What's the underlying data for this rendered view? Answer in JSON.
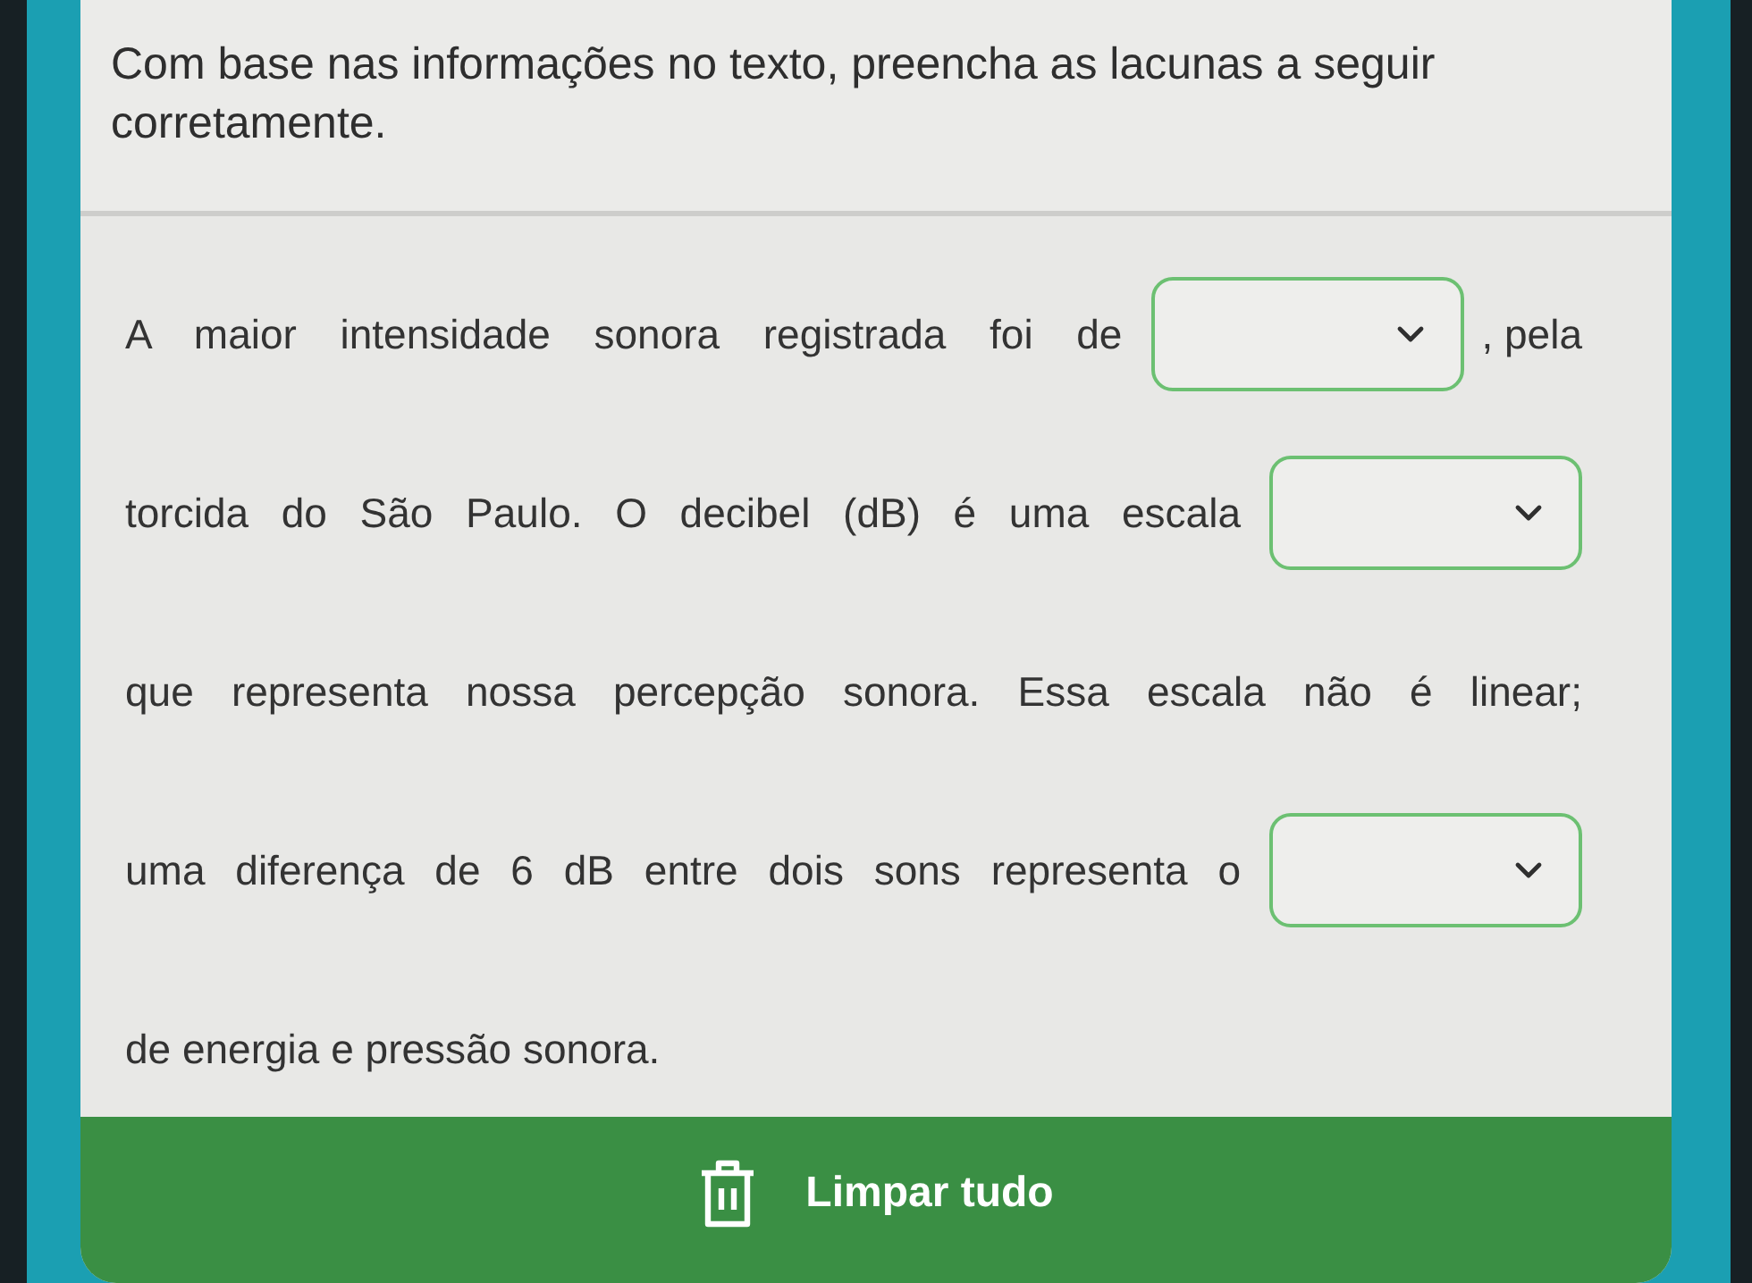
{
  "instruction": "Com base nas informações no texto, preencha as lacunas a seguir corretamente.",
  "lines": [
    {
      "parts": [
        {
          "kind": "text",
          "text": "A maior intensidade sonora registrada foi de"
        },
        {
          "kind": "dropdown"
        },
        {
          "kind": "text",
          "text": ", pela"
        }
      ]
    },
    {
      "parts": [
        {
          "kind": "text",
          "text": "torcida do São Paulo. O decibel (dB) é uma escala"
        },
        {
          "kind": "dropdown"
        }
      ]
    },
    {
      "parts": [
        {
          "kind": "text",
          "text": "que representa nossa percepção sonora. Essa escala não é linear;"
        }
      ]
    },
    {
      "parts": [
        {
          "kind": "text",
          "text": "uma diferença de 6 dB entre dois sons representa o"
        },
        {
          "kind": "dropdown"
        }
      ]
    },
    {
      "parts": [
        {
          "kind": "text",
          "text": "de energia e pressão sonora."
        }
      ]
    }
  ],
  "clear_button": {
    "label": "Limpar tudo"
  }
}
